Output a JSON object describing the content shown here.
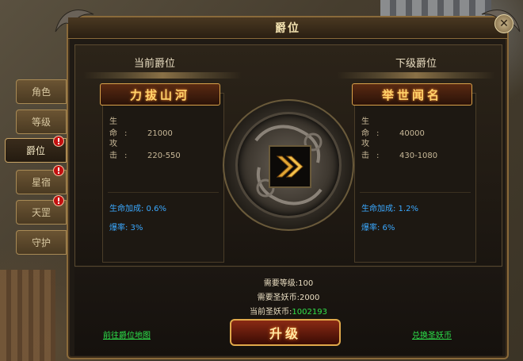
{
  "window": {
    "title": "爵位",
    "close": "✕"
  },
  "tabs": [
    {
      "label": "角色",
      "alert": false,
      "active": false
    },
    {
      "label": "等级",
      "alert": false,
      "active": false
    },
    {
      "label": "爵位",
      "alert": true,
      "active": true
    },
    {
      "label": "星宿",
      "alert": true,
      "active": false
    },
    {
      "label": "天罡",
      "alert": true,
      "active": false
    },
    {
      "label": "守护",
      "alert": false,
      "active": false
    }
  ],
  "alert_glyph": "!",
  "current": {
    "header": "当前爵位",
    "name": "力拔山河",
    "hp_label": "生 命:",
    "hp": "21000",
    "atk_label": "攻 击:",
    "atk": "220-550",
    "bonus_hp": "生命加成: 0.6%",
    "bonus_crit": "爆率: 3%"
  },
  "next": {
    "header": "下级爵位",
    "name": "举世闻名",
    "hp_label": "生 命:",
    "hp": "40000",
    "atk_label": "攻 击:",
    "atk": "430-1080",
    "bonus_hp": "生命加成: 1.2%",
    "bonus_crit": "爆率: 6%"
  },
  "requirements": {
    "level_label": "需要等级:",
    "level": "100",
    "coin_label": "需要圣妖币:",
    "coin": "2000",
    "have_label": "当前圣妖币:",
    "have": "1002193"
  },
  "buttons": {
    "map_link": "前往爵位地图",
    "upgrade": "升级",
    "exchange_link": "兑换圣妖币"
  },
  "colors": {
    "accent_gold": "#d9a24a",
    "name_glow": "#ffd36b",
    "bonus_blue": "#3aa8ff",
    "link_green": "#2de04a",
    "alert_red": "#c31010"
  }
}
